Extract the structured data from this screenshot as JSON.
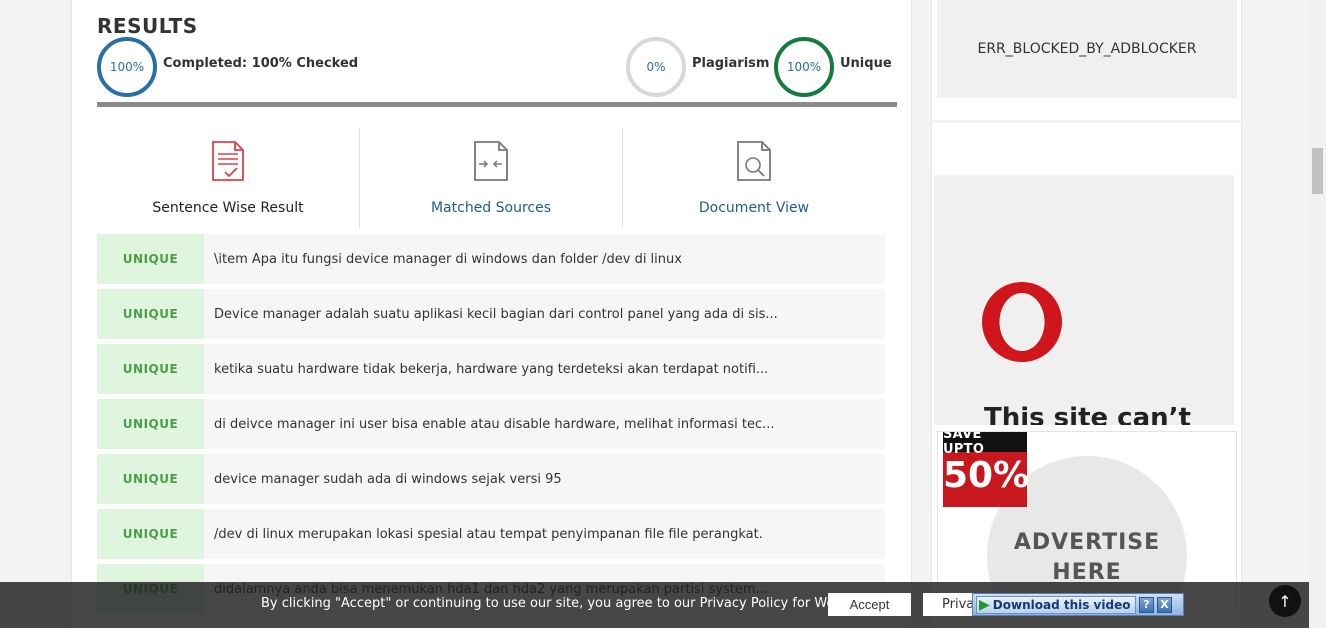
{
  "results": {
    "title": "RESULTS",
    "completed_value": "100%",
    "completed_label": "Completed:",
    "completed_detail": "100% Checked",
    "plagiarism_value": "0%",
    "plagiarism_label": "Plagiarism",
    "unique_value": "100%",
    "unique_label": "Unique",
    "progress": 1.0
  },
  "tabs": [
    {
      "label": "Sentence Wise Result",
      "icon": "document-check-icon"
    },
    {
      "label": "Matched Sources",
      "icon": "compare-document-icon"
    },
    {
      "label": "Document View",
      "icon": "document-search-icon"
    }
  ],
  "rows": [
    {
      "status": "UNIQUE",
      "text": "\\item Apa itu fungsi device manager di windows dan folder /dev di linux"
    },
    {
      "status": "UNIQUE",
      "text": "Device manager adalah suatu aplikasi kecil bagian dari control panel yang ada di sis..."
    },
    {
      "status": "UNIQUE",
      "text": "ketika suatu hardware tidak bekerja, hardware yang terdeteksi akan terdapat notifi..."
    },
    {
      "status": "UNIQUE",
      "text": "di deivce manager ini user bisa enable atau disable hardware, melihat informasi tec..."
    },
    {
      "status": "UNIQUE",
      "text": "device manager sudah ada di windows sejak versi 95"
    },
    {
      "status": "UNIQUE",
      "text": "/dev di linux merupakan lokasi spesial atau tempat penyimpanan file file perangkat."
    },
    {
      "status": "UNIQUE",
      "text": "didalamnya anda bisa menemukan hda1 dan hda2 yang merupakan partisi system..."
    }
  ],
  "sidebar": {
    "error_text": "ERR_BLOCKED_BY_ADBLOCKER",
    "opera_text": "This site can’t",
    "ad_badge_top": "SAVE UPTO",
    "ad_badge_big": "50%",
    "ad_line1": "ADVERTISE",
    "ad_line2": "HERE"
  },
  "cookie": {
    "text": "By clicking \"Accept\" or continuing to use our site, you agree to our Privacy Policy for Website",
    "accept_label": "Accept",
    "privacy_label": "Privacy"
  },
  "download_widget": {
    "label": "Download this video",
    "help_label": "?",
    "close_label": "X"
  },
  "to_top_label": "↑",
  "colors": {
    "accent_blue": "#2a6ea8",
    "unique_green": "#157a3e",
    "badge_green_bg": "#dff5dd",
    "badge_green_text": "#4a9e46"
  }
}
